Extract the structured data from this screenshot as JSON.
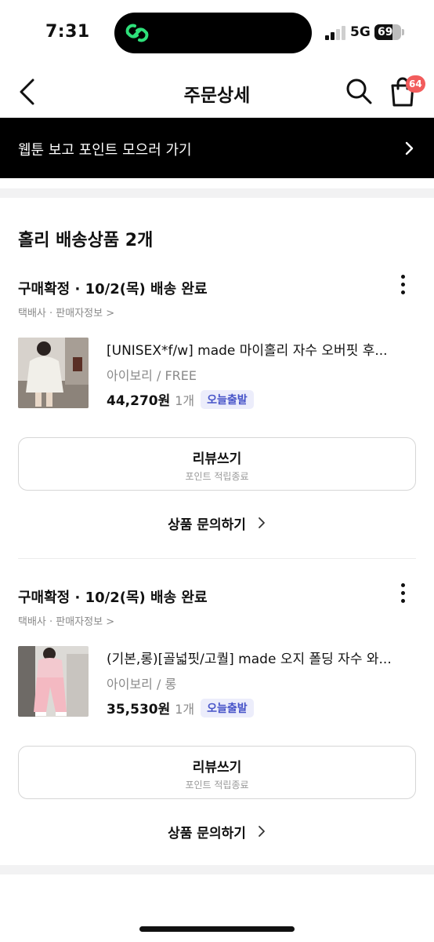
{
  "status_bar": {
    "time": "7:31",
    "network": "5G",
    "battery_level": "69",
    "battery_fraction": 0.69,
    "signal_bars_active": 2
  },
  "nav": {
    "title": "주문상세",
    "cart_count": "64",
    "icons": [
      "back-chevron-icon",
      "search-icon",
      "shopping-bag-icon"
    ]
  },
  "banner": {
    "text": "웹툰 보고 포인트 모으러 가기"
  },
  "section": {
    "title": "홀리 배송상품 2개"
  },
  "orders": [
    {
      "status": "구매확정 · 10/2(목) 배송 완료",
      "meta": "택배사 · 판매자정보 >",
      "product_name": "[UNISEX*f/w] made 마이홀리 자수 오버핏 후...",
      "option": "아이보리 / FREE",
      "price": "44,270원",
      "quantity": "1개",
      "badge": "오늘출발",
      "review_label": "리뷰쓰기",
      "review_sub": "포인트 적립종료",
      "inquiry_label": "상품 문의하기"
    },
    {
      "status": "구매확정 · 10/2(목) 배송 완료",
      "meta": "택배사 · 판매자정보 >",
      "product_name": "(기본,롱)[골넓핏/고퀄] made 오지 폴딩 자수 와...",
      "option": "아이보리 / 롱",
      "price": "35,530원",
      "quantity": "1개",
      "badge": "오늘출발",
      "review_label": "리뷰쓰기",
      "review_sub": "포인트 적립종료",
      "inquiry_label": "상품 문의하기"
    }
  ],
  "colors": {
    "badge_text": "#4653c8",
    "badge_bg": "#ecedfb",
    "cart_badge": "#f25c5c",
    "banner_bg": "#000000",
    "app_icon_green": "#2ee07a"
  }
}
